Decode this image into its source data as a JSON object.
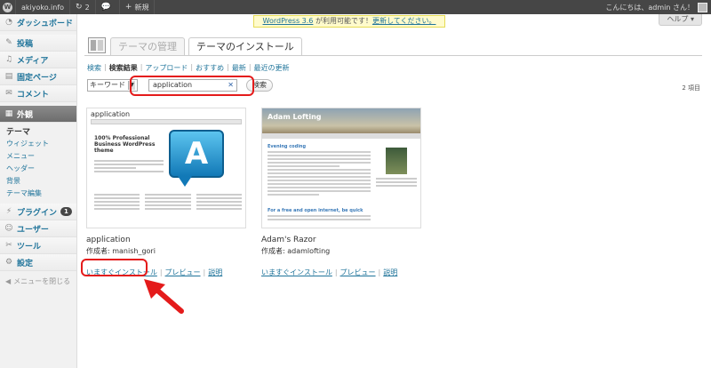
{
  "adminbar": {
    "site_name": "akiyoko.info",
    "updates_count": "2",
    "comments_count": "",
    "new_label": "新規",
    "greeting": "こんにちは、admin さん！"
  },
  "notice": {
    "prefix": "WordPress 3.6",
    "text": " が利用可能です！",
    "link": "更新してください。"
  },
  "help_label": "ヘルプ",
  "sidebar": {
    "dashboard": "ダッシュボード",
    "posts": "投稿",
    "media": "メディア",
    "pages": "固定ページ",
    "comments": "コメント",
    "appearance": "外観",
    "sub_heading": "テーマ",
    "sub_items": [
      "ウィジェット",
      "メニュー",
      "ヘッダー",
      "背景",
      "テーマ編集"
    ],
    "plugins": "プラグイン",
    "plugins_badge": "1",
    "users": "ユーザー",
    "tools": "ツール",
    "settings": "設定",
    "collapse": "メニューを閉じる"
  },
  "tabs": [
    "テーマの管理",
    "テーマのインストール"
  ],
  "subnav": [
    "検索",
    "検索結果",
    "アップロード",
    "おすすめ",
    "最新",
    "最近の更新"
  ],
  "search": {
    "type": "キーワード",
    "value": "application",
    "button": "検索"
  },
  "count": "2 項目",
  "themes": [
    {
      "name": "application",
      "author": "作成者: manish_gori",
      "install": "いますぐインストール",
      "preview": "プレビュー",
      "details": "説明",
      "thumb_title": "application",
      "thumb_heading": "100% Professional Business WordPress theme",
      "thumb_logo": "A"
    },
    {
      "name": "Adam's Razor",
      "author": "作成者: adamlofting",
      "install": "いますぐインストール",
      "preview": "プレビュー",
      "details": "説明",
      "thumb_title": "Adam Lofting",
      "thumb_h1": "Evening coding",
      "thumb_h2": "For a free and open internet, be quick"
    }
  ],
  "colors": {
    "link": "#21759b",
    "highlight": "#e41b1b",
    "adminbar": "#464646"
  }
}
